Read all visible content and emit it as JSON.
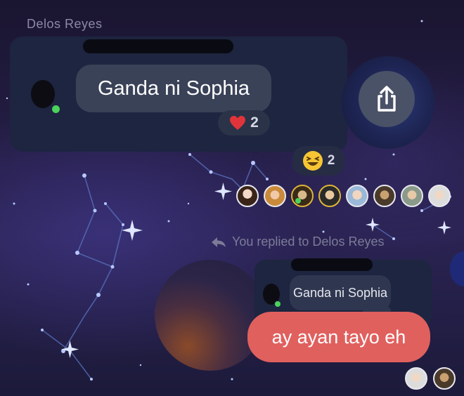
{
  "thread": {
    "sender_name": "Delos Reyes",
    "quoted_message": {
      "text": "Ganda ni Sophia",
      "reaction_count": "2"
    },
    "group_reaction_count": "2",
    "seen_by_count_visible": 8,
    "reply_context": "You replied to Delos Reyes",
    "reply_quoted_text": "Ganda ni Sophia",
    "my_reply": "ay ayan tayo eh"
  },
  "icons": {
    "share": "share-icon",
    "heart": "heart-icon",
    "laugh": "laughing-emoji-icon",
    "reply_arrow": "reply-arrow-icon"
  },
  "colors": {
    "my_bubble": "#e0605e",
    "card_bg": "#1d2540",
    "quote_bubble": "#3a4258",
    "online": "#4bd35c"
  }
}
